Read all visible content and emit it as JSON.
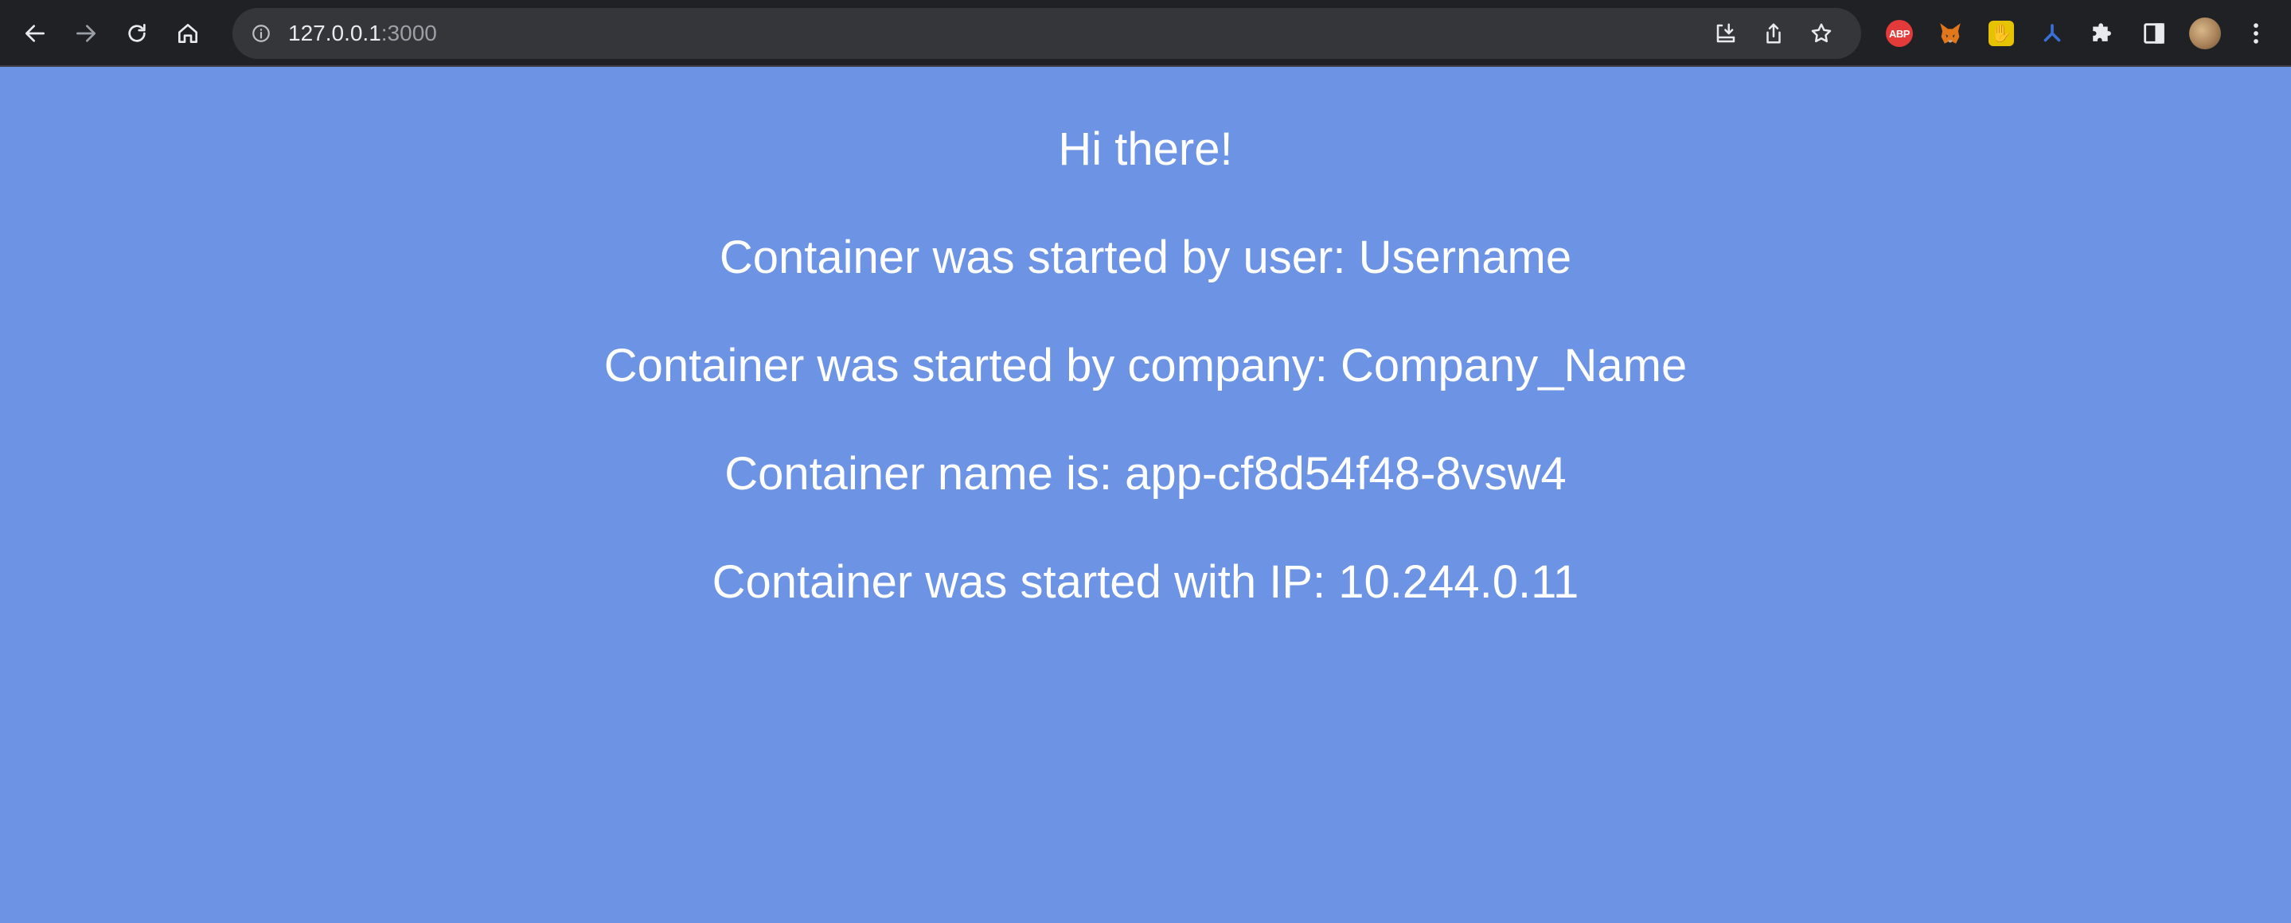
{
  "browser": {
    "url_host": "127.0.0.1",
    "url_port": ":3000",
    "extensions": {
      "abp_label": "ABP"
    },
    "icons": [
      "back-icon",
      "forward-icon",
      "reload-icon",
      "home-icon",
      "info-icon",
      "install-icon",
      "share-icon",
      "bookmark-star-icon",
      "abp-icon",
      "metamask-fox-icon",
      "hand-icon",
      "ext-blue-icon",
      "puzzle-icon",
      "side-panel-icon",
      "profile-avatar",
      "menu-dots-icon"
    ]
  },
  "page": {
    "background_color": "#6d93e5",
    "greeting": "Hi there!",
    "user_line": "Container was started by user: Username",
    "company_line": "Container was started by company: Company_Name",
    "name_line": "Container name is: app-cf8d54f48-8vsw4",
    "ip_line": "Container was started with IP: 10.244.0.11"
  }
}
